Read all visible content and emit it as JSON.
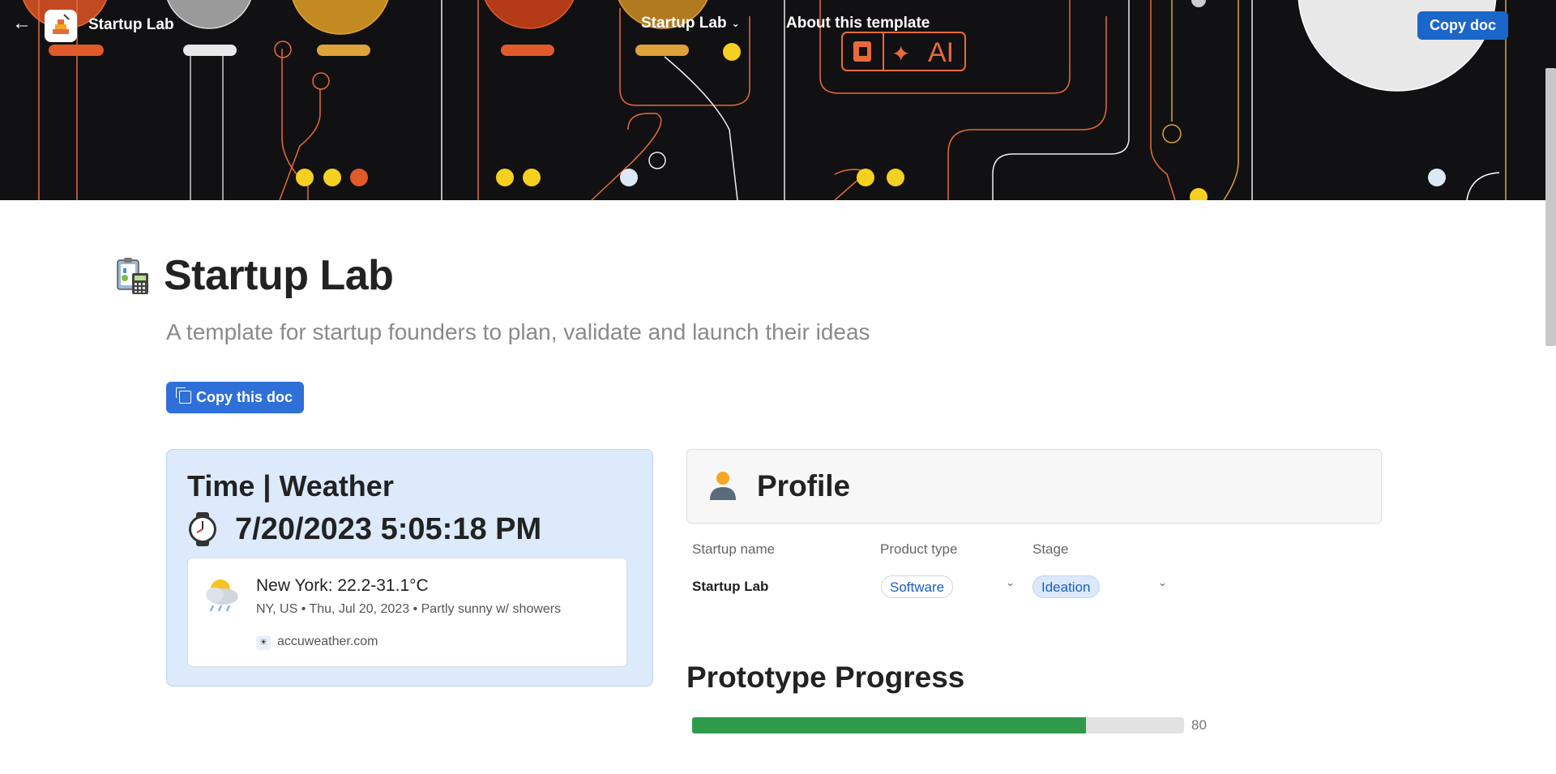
{
  "topbar": {
    "app_title": "Startup Lab",
    "doc_menu_label": "Startup Lab",
    "about_label": "About this template",
    "copy_doc_label": "Copy doc"
  },
  "banner": {
    "ai_badge_text": "AI"
  },
  "doc": {
    "title": "Startup Lab",
    "subtitle": "A template for startup founders to plan, validate and launch their ideas",
    "copy_button_label": "Copy this doc"
  },
  "weather": {
    "title": "Time | Weather",
    "datetime": "7/20/2023 5:05:18 PM",
    "city_line": "New York: 22.2-31.1°C",
    "details": "NY, US • Thu, Jul 20, 2023 • Partly sunny w/ showers",
    "source": "accuweather.com"
  },
  "profile": {
    "title": "Profile",
    "columns": [
      "Startup name",
      "Product type",
      "Stage"
    ],
    "row": {
      "startup_name": "Startup Lab",
      "product_type": "Software",
      "stage": "Ideation"
    }
  },
  "prototype": {
    "title": "Prototype Progress",
    "progress_value": 80,
    "progress_label": "80"
  },
  "colors": {
    "banner_bg": "#111113",
    "accent_blue": "#1b66c9",
    "progress_green": "#2f9a4b",
    "weather_bg": "#dceafb"
  },
  "icons": [
    "back-arrow-icon",
    "app-logo-icon",
    "chevron-down-icon",
    "clipboard-calculator-icon",
    "watch-icon",
    "partly-sunny-showers-icon",
    "accuweather-icon",
    "person-icon",
    "copy-icon"
  ]
}
